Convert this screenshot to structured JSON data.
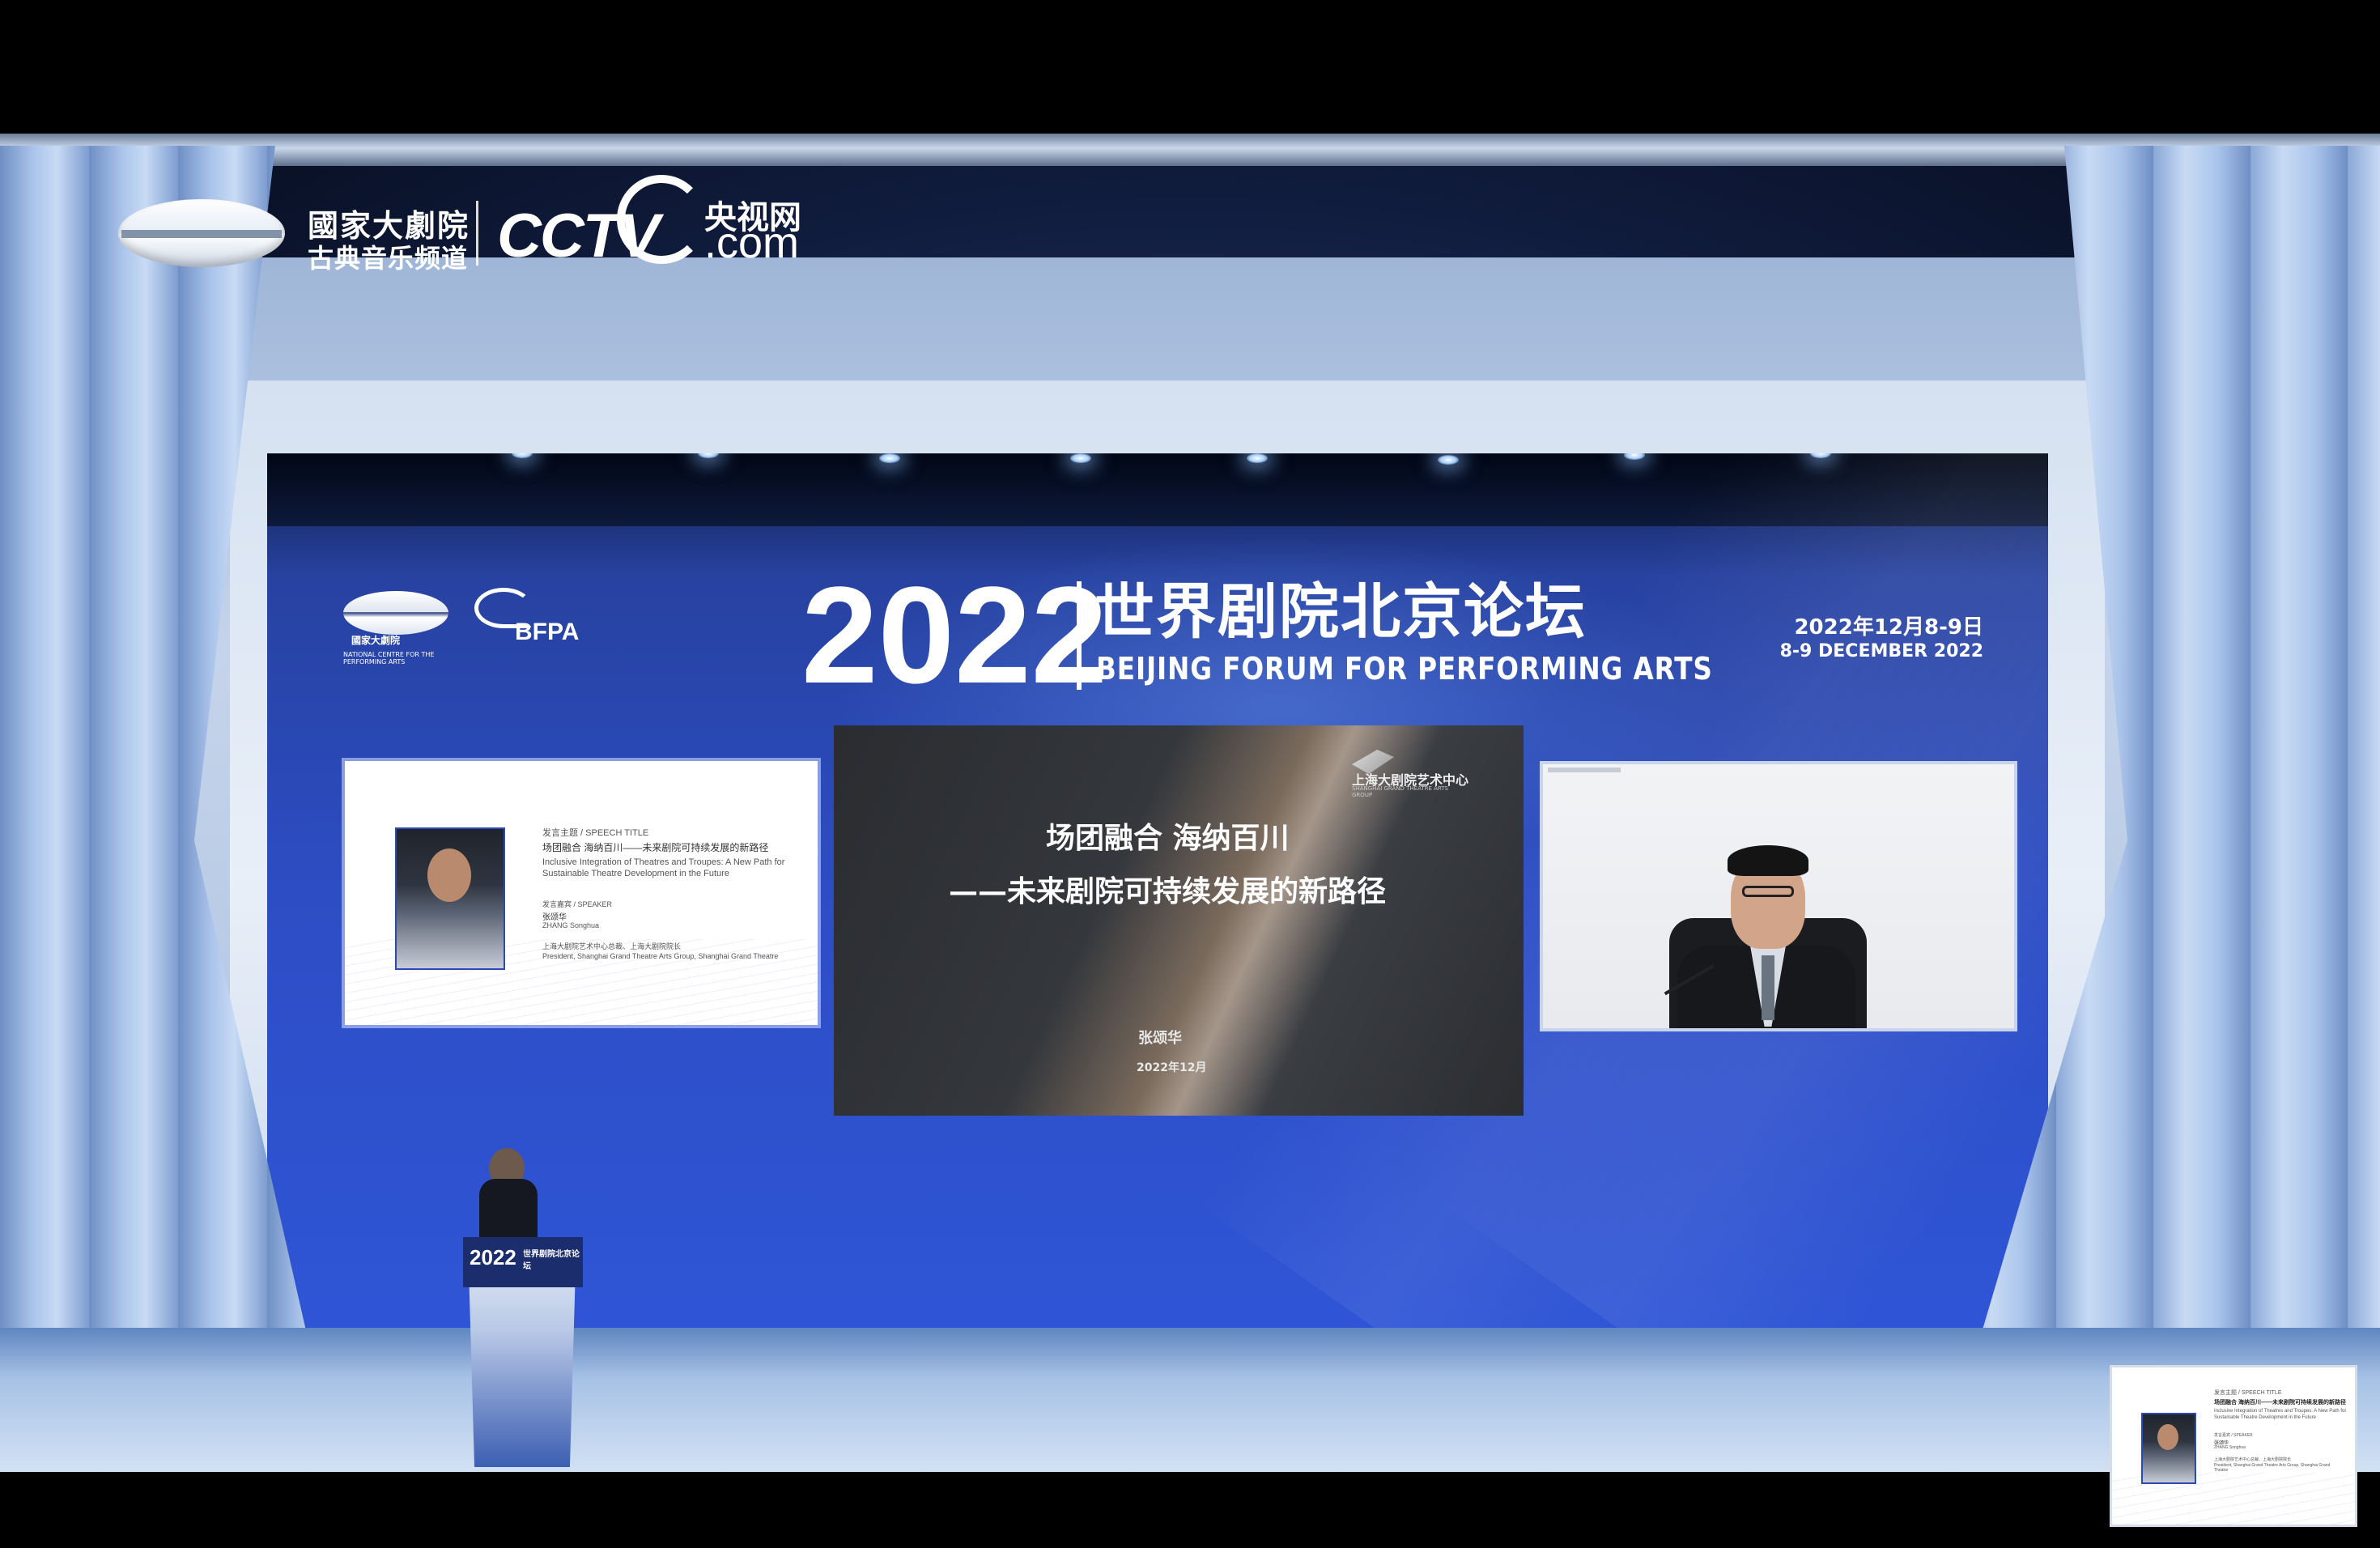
{
  "broadcast": {
    "ncpa_name_cn": "國家大劇院",
    "channel_cn": "古典音乐频道",
    "cctv_logo_text": "CCTV",
    "cctv_suffix": ".com",
    "cctv_site_cn": "央视网"
  },
  "forum": {
    "year": "2022",
    "title_cn": "世界剧院北京论坛",
    "title_en": "BEIJING FORUM FOR PERFORMING ARTS",
    "date_cn": "2022年12月8-9日",
    "date_en": "8-9 DECEMBER 2022",
    "ncpa_logo_cn": "國家大劇院",
    "ncpa_logo_en": "NATIONAL CENTRE FOR THE PERFORMING ARTS",
    "bfpa_logo": "BFPA"
  },
  "speaker_card": {
    "speech_title_label": "发言主题 / SPEECH TITLE",
    "speech_title_cn": "场团融合 海纳百川——未来剧院可持续发展的新路径",
    "speech_title_en": "Inclusive Integration of Theatres and Troupes: A New Path for Sustainable Theatre Development in the Future",
    "speaker_label": "发言嘉宾 / SPEAKER",
    "speaker_name_cn": "张颂华",
    "speaker_name_en": "ZHANG Songhua",
    "speaker_role_cn": "上海大剧院艺术中心总裁、上海大剧院院长",
    "speaker_role_en": "President, Shanghai Grand Theatre Arts Group, Shanghai Grand Theatre"
  },
  "slide": {
    "org_cn": "上海大剧院艺术中心",
    "org_en": "SHANGHAI GRAND THEATRE ARTS GROUP",
    "title_line1": "场团融合  海纳百川",
    "title_line2": "——未来剧院可持续发展的新路径",
    "presenter": "张颂华",
    "date": "2022年12月"
  },
  "podium": {
    "year": "2022",
    "title_cn": "世界剧院北京论坛"
  },
  "colors": {
    "led_blue": "#2d4dc4",
    "frame": "#c5d4ea",
    "slide_dark": "#2a2c30"
  }
}
